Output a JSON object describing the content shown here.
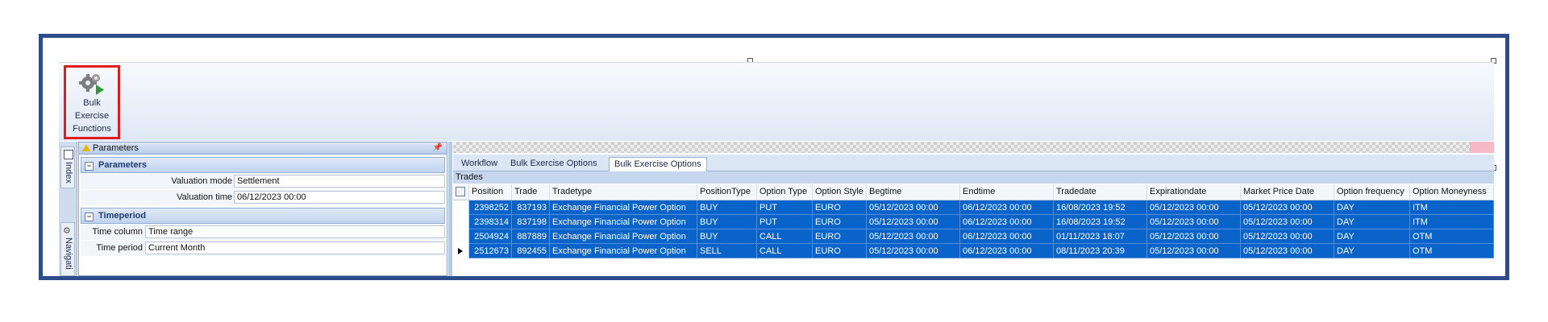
{
  "ribbon": {
    "bulk_button": [
      "Bulk",
      "Exercise",
      "Functions"
    ]
  },
  "side_tabs": {
    "index": "Index",
    "navigation": "Navigati"
  },
  "params_panel": {
    "title": "Parameters",
    "parameters_section": "Parameters",
    "valuation_mode_label": "Valuation mode",
    "valuation_mode_value": "Settlement",
    "valuation_time_label": "Valuation time",
    "valuation_time_value": "06/12/2023 00:00",
    "timeperiod_section": "Timeperiod",
    "time_column_label": "Time column",
    "time_column_value": "Time range",
    "time_period_label": "Time period",
    "time_period_value": "Current Month"
  },
  "tabs": [
    "Workflow",
    "Bulk Exercise Options",
    "Bulk Exercise Options"
  ],
  "grid": {
    "title": "Trades",
    "columns": [
      "Position",
      "Trade",
      "Tradetype",
      "PositionType",
      "Option Type",
      "Option Style",
      "Begtime",
      "Endtime",
      "Tradedate",
      "Expirationdate",
      "Market Price Date",
      "Option frequency",
      "Option Moneyness"
    ],
    "rows": [
      [
        "2398252",
        "837193",
        "Exchange Financial Power Option",
        "BUY",
        "PUT",
        "EURO",
        "05/12/2023 00:00",
        "06/12/2023 00:00",
        "16/08/2023 19:52",
        "05/12/2023 00:00",
        "05/12/2023 00:00",
        "DAY",
        "ITM"
      ],
      [
        "2398314",
        "837198",
        "Exchange Financial Power Option",
        "BUY",
        "PUT",
        "EURO",
        "05/12/2023 00:00",
        "06/12/2023 00:00",
        "16/08/2023 19:52",
        "05/12/2023 00:00",
        "05/12/2023 00:00",
        "DAY",
        "ITM"
      ],
      [
        "2504924",
        "887889",
        "Exchange Financial Power Option",
        "BUY",
        "CALL",
        "EURO",
        "05/12/2023 00:00",
        "06/12/2023 00:00",
        "01/11/2023 18:07",
        "05/12/2023 00:00",
        "05/12/2023 00:00",
        "DAY",
        "OTM"
      ],
      [
        "2512673",
        "892455",
        "Exchange Financial Power Option",
        "SELL",
        "CALL",
        "EURO",
        "05/12/2023 00:00",
        "06/12/2023 00:00",
        "08/11/2023 20:39",
        "05/12/2023 00:00",
        "05/12/2023 00:00",
        "DAY",
        "OTM"
      ]
    ],
    "current_row": 3
  },
  "colors": {
    "frame": "#2e4b8c",
    "selection": "#0a63c9",
    "highlight_box": "#e21b1b"
  }
}
